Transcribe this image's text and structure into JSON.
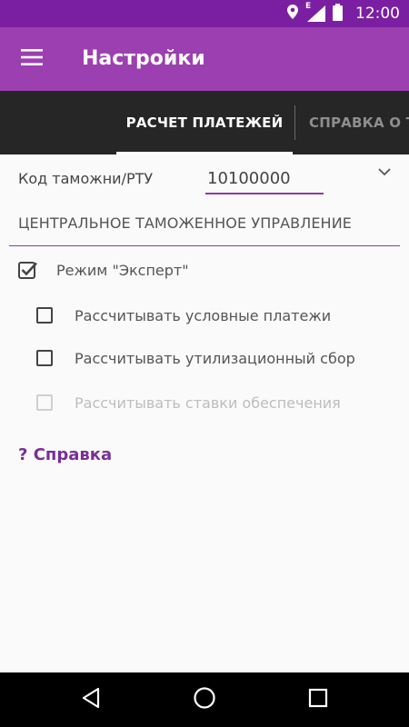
{
  "status_bar": {
    "time": "12:00",
    "network_label": "E",
    "icons": [
      "location-icon",
      "signal-icon",
      "battery-icon"
    ]
  },
  "app_bar": {
    "title": "Настройки",
    "menu_icon": "hamburger-menu-icon"
  },
  "tabs": [
    {
      "label": "РАСЧЕТ ПЛАТЕЖЕЙ",
      "active": true
    },
    {
      "label": "СПРАВКА О ТОВАРАХ",
      "active": false
    }
  ],
  "customs_field": {
    "label": "Код таможни/РТУ",
    "value": "10100000",
    "dropdown_icon": "chevron-down-icon"
  },
  "customs_name": "ЦЕНТРАЛЬНОЕ ТАМОЖЕННОЕ УПРАВЛЕНИЕ",
  "options": {
    "expert_mode": {
      "label": "Режим \"Эксперт\"",
      "checked": true
    },
    "conditional_payments": {
      "label": "Рассчитывать условные платежи",
      "checked": false
    },
    "recycling_fee": {
      "label": "Рассчитывать утилизационный сбор",
      "checked": false
    },
    "security_rates": {
      "label": "Рассчитывать ставки обеспечения",
      "checked": false,
      "disabled": true
    }
  },
  "help_link": "? Справка",
  "nav_bar": {
    "icons": [
      "back-icon",
      "home-icon",
      "recents-icon"
    ]
  },
  "colors": {
    "status_bar": "#7b1fa2",
    "app_bar": "#9c3fb0",
    "tab_bar": "#262626",
    "accent": "#8e3aa6",
    "link": "#7b2d98"
  }
}
